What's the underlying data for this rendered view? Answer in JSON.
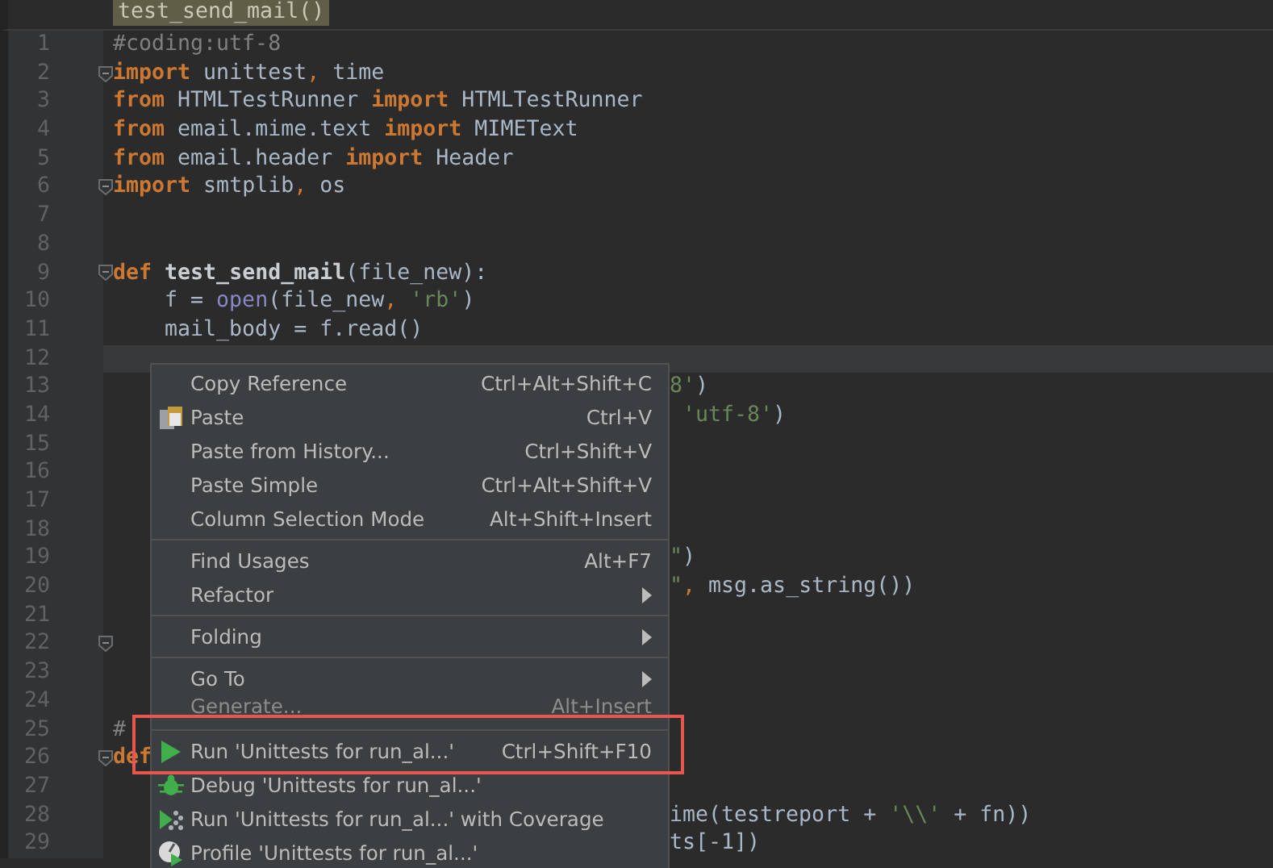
{
  "breadcrumb": "test_send_mail()",
  "lines": [
    {
      "number": "1",
      "fold": false,
      "current": false,
      "segments": [
        {
          "text": "#coding:utf-8",
          "kind": "comment"
        }
      ]
    },
    {
      "number": "2",
      "fold": true,
      "current": false,
      "segments": [
        {
          "text": "import",
          "kind": "keyword"
        },
        {
          "text": " unittest",
          "kind": "plain"
        },
        {
          "text": ", ",
          "kind": "punct"
        },
        {
          "text": "time",
          "kind": "plain"
        }
      ]
    },
    {
      "number": "3",
      "fold": false,
      "current": false,
      "segments": [
        {
          "text": "from",
          "kind": "keyword"
        },
        {
          "text": " HTMLTestRunner ",
          "kind": "plain"
        },
        {
          "text": "import",
          "kind": "keyword"
        },
        {
          "text": " HTMLTestRunner",
          "kind": "plain"
        }
      ]
    },
    {
      "number": "4",
      "fold": false,
      "current": false,
      "segments": [
        {
          "text": "from",
          "kind": "keyword"
        },
        {
          "text": " email.mime.text ",
          "kind": "plain"
        },
        {
          "text": "import",
          "kind": "keyword"
        },
        {
          "text": " MIMEText",
          "kind": "plain"
        }
      ]
    },
    {
      "number": "5",
      "fold": false,
      "current": false,
      "segments": [
        {
          "text": "from",
          "kind": "keyword"
        },
        {
          "text": " email.header ",
          "kind": "plain"
        },
        {
          "text": "import",
          "kind": "keyword"
        },
        {
          "text": " Header",
          "kind": "plain"
        }
      ]
    },
    {
      "number": "6",
      "fold": true,
      "current": false,
      "segments": [
        {
          "text": "import",
          "kind": "keyword"
        },
        {
          "text": " smtplib",
          "kind": "plain"
        },
        {
          "text": ", ",
          "kind": "punct"
        },
        {
          "text": "os",
          "kind": "plain"
        }
      ]
    },
    {
      "number": "7",
      "fold": false,
      "current": false
    },
    {
      "number": "8",
      "fold": false,
      "current": false
    },
    {
      "number": "9",
      "fold": true,
      "current": false,
      "segments": [
        {
          "text": "def",
          "kind": "keyword"
        },
        {
          "text": " test_send_mail",
          "kind": "defname"
        },
        {
          "text": "(file_new):",
          "kind": "plain"
        }
      ]
    },
    {
      "number": "10",
      "fold": false,
      "current": false,
      "segments": [
        {
          "text": "    f = ",
          "kind": "plain"
        },
        {
          "text": "open",
          "kind": "builtin"
        },
        {
          "text": "(file_new",
          "kind": "plain"
        },
        {
          "text": ", ",
          "kind": "punct"
        },
        {
          "text": "'rb'",
          "kind": "string"
        },
        {
          "text": ")",
          "kind": "plain"
        }
      ]
    },
    {
      "number": "11",
      "fold": false,
      "current": false,
      "segments": [
        {
          "text": "    mail_body = f.read()",
          "kind": "plain"
        }
      ]
    },
    {
      "number": "12",
      "fold": false,
      "current": true
    },
    {
      "number": "13",
      "fold": false,
      "current": false,
      "after_menu": [
        {
          "text": "8'",
          "kind": "string"
        },
        {
          "text": ")",
          "kind": "plain"
        }
      ]
    },
    {
      "number": "14",
      "fold": false,
      "current": false,
      "after_menu": [
        {
          "text": " 'utf-8'",
          "kind": "string"
        },
        {
          "text": ")",
          "kind": "plain"
        }
      ]
    },
    {
      "number": "15",
      "fold": false,
      "current": false
    },
    {
      "number": "16",
      "fold": false,
      "current": false
    },
    {
      "number": "17",
      "fold": false,
      "current": false
    },
    {
      "number": "18",
      "fold": false,
      "current": false
    },
    {
      "number": "19",
      "fold": false,
      "current": false,
      "after_menu": [
        {
          "text": "\"",
          "kind": "string"
        },
        {
          "text": ")",
          "kind": "plain"
        }
      ]
    },
    {
      "number": "20",
      "fold": false,
      "current": false,
      "after_menu": [
        {
          "text": "\"",
          "kind": "string"
        },
        {
          "text": ", ",
          "kind": "punct"
        },
        {
          "text": "msg.as_string())",
          "kind": "plain"
        }
      ]
    },
    {
      "number": "21",
      "fold": false,
      "current": false
    },
    {
      "number": "22",
      "fold": true,
      "current": false
    },
    {
      "number": "23",
      "fold": false,
      "current": false
    },
    {
      "number": "24",
      "fold": false,
      "current": false
    },
    {
      "number": "25",
      "fold": false,
      "current": false,
      "segments": [
        {
          "text": "#",
          "kind": "comment"
        }
      ]
    },
    {
      "number": "26",
      "fold": true,
      "current": false,
      "segments": [
        {
          "text": "def",
          "kind": "keyword"
        }
      ]
    },
    {
      "number": "27",
      "fold": false,
      "current": false
    },
    {
      "number": "28",
      "fold": false,
      "current": false,
      "after_menu": [
        {
          "text": "ime(testreport + ",
          "kind": "plain"
        },
        {
          "text": "'\\\\'",
          "kind": "string"
        },
        {
          "text": " + fn))",
          "kind": "plain"
        }
      ]
    },
    {
      "number": "29",
      "fold": false,
      "current": false,
      "after_menu": [
        {
          "text": "ts[-1])",
          "kind": "plain"
        }
      ]
    }
  ],
  "context_menu": {
    "groups": [
      [
        {
          "label": "Copy Reference",
          "shortcut": "Ctrl+Alt+Shift+C",
          "kind": "plain",
          "disabled": false
        },
        {
          "label": "Paste",
          "shortcut": "Ctrl+V",
          "kind": "paste",
          "disabled": false
        },
        {
          "label": "Paste from History...",
          "shortcut": "Ctrl+Shift+V",
          "kind": "plain",
          "disabled": false
        },
        {
          "label": "Paste Simple",
          "shortcut": "Ctrl+Alt+Shift+V",
          "kind": "plain",
          "disabled": false
        },
        {
          "label": "Column Selection Mode",
          "shortcut": "Alt+Shift+Insert",
          "kind": "plain",
          "disabled": false
        }
      ],
      [
        {
          "label": "Find Usages",
          "shortcut": "Alt+F7",
          "kind": "plain",
          "disabled": false
        },
        {
          "label": "Refactor",
          "kind": "submenu",
          "disabled": false
        }
      ],
      [
        {
          "label": "Folding",
          "kind": "submenu",
          "disabled": false
        }
      ],
      [
        {
          "label": "Go To",
          "kind": "submenu",
          "disabled": false
        },
        {
          "label": "Generate...",
          "shortcut": "Alt+Insert",
          "kind": "plain",
          "disabled": true
        }
      ],
      [
        {
          "label": "Run 'Unittests for run_al...'",
          "shortcut": "Ctrl+Shift+F10",
          "kind": "run",
          "disabled": false
        },
        {
          "label": "Debug 'Unittests for run_al...'",
          "kind": "debug",
          "disabled": false
        },
        {
          "label": "Run 'Unittests for run_al...' with Coverage",
          "kind": "coverage",
          "disabled": false
        },
        {
          "label": "Profile 'Unittests for run_al...'",
          "kind": "profile",
          "disabled": false
        }
      ]
    ]
  }
}
